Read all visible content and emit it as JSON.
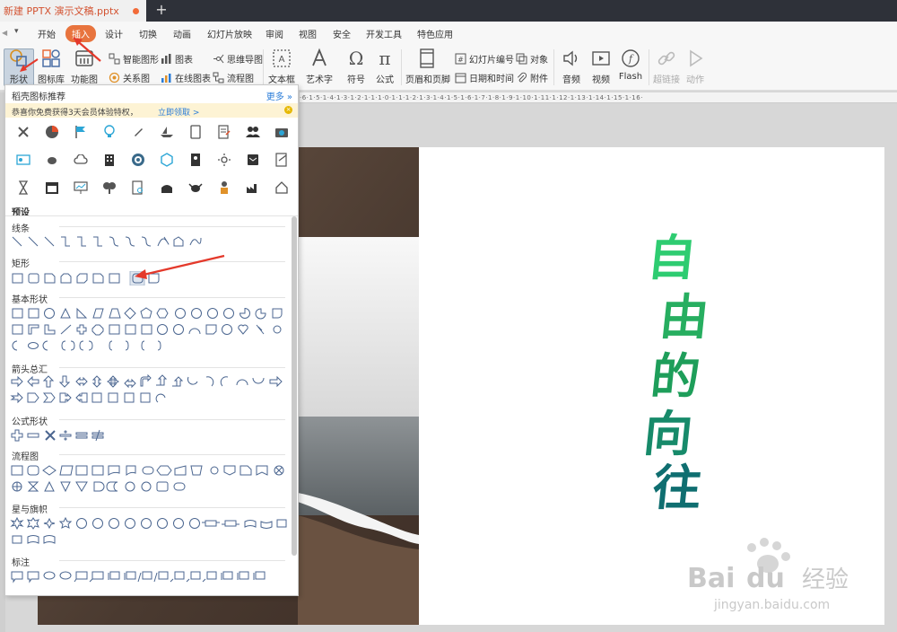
{
  "window": {
    "doc_tab_title": "新建 PPTX 演示文稿.pptx",
    "new_tab_label": "+"
  },
  "menu": {
    "tabs": [
      {
        "label": "开始"
      },
      {
        "label": "插入",
        "active": true
      },
      {
        "label": "设计"
      },
      {
        "label": "切换"
      },
      {
        "label": "动画"
      },
      {
        "label": "幻灯片放映"
      },
      {
        "label": "审阅"
      },
      {
        "label": "视图"
      },
      {
        "label": "安全"
      },
      {
        "label": "开发工具"
      },
      {
        "label": "特色应用"
      }
    ]
  },
  "ribbon": {
    "shape": "形状",
    "icon_lib": "图标库",
    "func_chart": "功能图",
    "smart_art": "智能图形",
    "chart": "图表",
    "mind_map": "思维导图",
    "relation": "关系图",
    "online_chart": "在线图表",
    "flowchart": "流程图",
    "textbox": "文本框",
    "art_text": "艺术字",
    "symbol": "符号",
    "formula": "公式",
    "header_footer": "页眉和页脚",
    "slide_number": "幻灯片编号",
    "object": "对象",
    "date_time": "日期和时间",
    "attachment": "附件",
    "audio": "音频",
    "video": "视频",
    "flash": "Flash",
    "hyperlink": "超链接",
    "action": "动作"
  },
  "ruler": {
    "text": "·6·1·5·1·4·1·3·1·2·1·1·1·0·1·1·1·2·1·3·1·4·1·5·1·6·1·7·1·8·1·9·1·10·1·11·1·12·1·13·1·14·1·15·1·16·"
  },
  "slide": {
    "chars": [
      "自",
      "由",
      "的",
      "向",
      "往"
    ],
    "colors": [
      "#2ecc71",
      "#27ae60",
      "#1e9e5a",
      "#178a6a",
      "#0f6e70"
    ]
  },
  "panel": {
    "title": "稻壳图标推荐",
    "more": "更多",
    "promo_text": "恭喜你免费获得3天会员体验特权，",
    "promo_link": "立即领取 >",
    "preset_label": "预设",
    "categories": {
      "lines": "线条",
      "rect": "矩形",
      "basic": "基本形状",
      "arrows": "箭头总汇",
      "equation": "公式形状",
      "flow": "流程图",
      "stars": "星与旗帜",
      "callout": "标注"
    }
  },
  "watermark": {
    "brand": "Bai",
    "brand2": "经验",
    "url": "jingyan.baidu.com"
  }
}
